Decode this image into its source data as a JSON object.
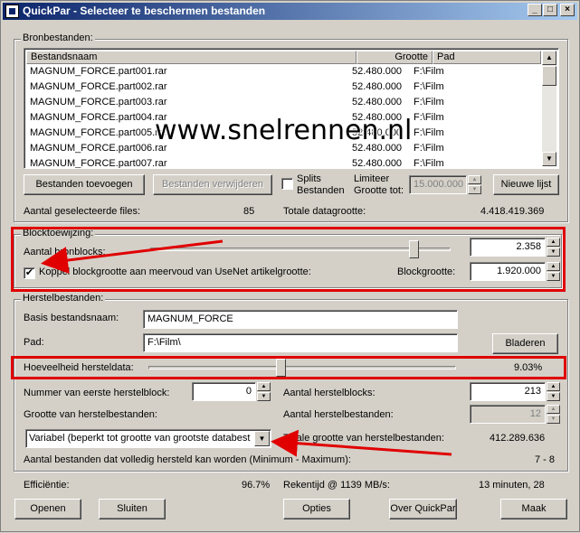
{
  "window": {
    "title": "QuickPar - Selecteer te beschermen bestanden",
    "controls": {
      "minimize": "_",
      "maximize": "□",
      "close": "×"
    }
  },
  "source_files": {
    "group_title": "Bronbestanden:",
    "columns": {
      "name": "Bestandsnaam",
      "size": "Grootte",
      "path": "Pad"
    },
    "rows": [
      {
        "name": "MAGNUM_FORCE.part001.rar",
        "size": "52.480.000",
        "path": "F:\\Film"
      },
      {
        "name": "MAGNUM_FORCE.part002.rar",
        "size": "52.480.000",
        "path": "F:\\Film"
      },
      {
        "name": "MAGNUM_FORCE.part003.rar",
        "size": "52.480.000",
        "path": "F:\\Film"
      },
      {
        "name": "MAGNUM_FORCE.part004.rar",
        "size": "52.480.000",
        "path": "F:\\Film"
      },
      {
        "name": "MAGNUM_FORCE.part005.rar",
        "size": "52.480.000",
        "path": "F:\\Film"
      },
      {
        "name": "MAGNUM_FORCE.part006.rar",
        "size": "52.480.000",
        "path": "F:\\Film"
      },
      {
        "name": "MAGNUM_FORCE.part007.rar",
        "size": "52.480.000",
        "path": "F:\\Film"
      }
    ],
    "add_button": "Bestanden toevoegen",
    "remove_button": "Bestanden verwijderen",
    "split_checkbox_line1": "Splits",
    "split_checkbox_line2": "Bestanden",
    "limit_label_line1": "Limiteer",
    "limit_label_line2": "Grootte tot:",
    "limit_value": "15.000.000",
    "new_list_button": "Nieuwe lijst",
    "selected_count_label": "Aantal geselecteerde files:",
    "selected_count": "85",
    "total_size_label": "Totale datagrootte:",
    "total_size": "4.418.419.369"
  },
  "watermark": "www.snelrennen.nl",
  "block_allocation": {
    "group_title": "Blocktoewijzing:",
    "source_blocks_label": "Aantal bronblocks:",
    "source_blocks_value": "2.358",
    "source_blocks_slider": 0.89,
    "link_checkbox_label": "Koppel blockgrootte aan meervoud van UseNet artikelgrootte:",
    "link_checked": "✔",
    "block_size_label": "Blockgrootte:",
    "block_size_value": "1.920.000"
  },
  "recovery_files": {
    "group_title": "Herstelbestanden:",
    "base_name_label": "Basis bestandsnaam:",
    "base_name_value": "MAGNUM_FORCE",
    "path_label": "Pad:",
    "path_value": "F:\\Film\\",
    "browse_button": "Bladeren",
    "amount_label": "Hoeveelheid hersteldata:",
    "amount_value": "9.03%",
    "amount_slider": 0.43,
    "first_block_label": "Nummer van eerste herstelblock:",
    "first_block_value": "0",
    "recovery_blocks_label": "Aantal herstelblocks:",
    "recovery_blocks_value": "213",
    "size_label": "Grootte van herstelbestanden:",
    "files_label": "Aantal herstelbestanden:",
    "files_value": "12",
    "size_option": "Variabel (beperkt tot grootte van grootste databest",
    "total_size_label": "Totale grootte van herstelbestanden:",
    "total_size_value": "412.289.636",
    "fully_recoverable_label": "Aantal bestanden dat volledig hersteld kan worden (Minimum - Maximum):",
    "fully_recoverable_value": "7 - 8"
  },
  "footer": {
    "efficiency_label": "Efficiëntie:",
    "efficiency_value": "96.7%",
    "compute_label": "Rekentijd @ 1139 MB/s:",
    "compute_value": "13 minuten, 28",
    "open_button": "Openen",
    "close_button": "Sluiten",
    "options_button": "Opties",
    "about_button": "Over QuickPar",
    "create_button": "Maak"
  },
  "colors": {
    "highlight": "#e00000",
    "face": "#d4d0c8",
    "title_start": "#0a246a",
    "title_end": "#a6caf0"
  }
}
